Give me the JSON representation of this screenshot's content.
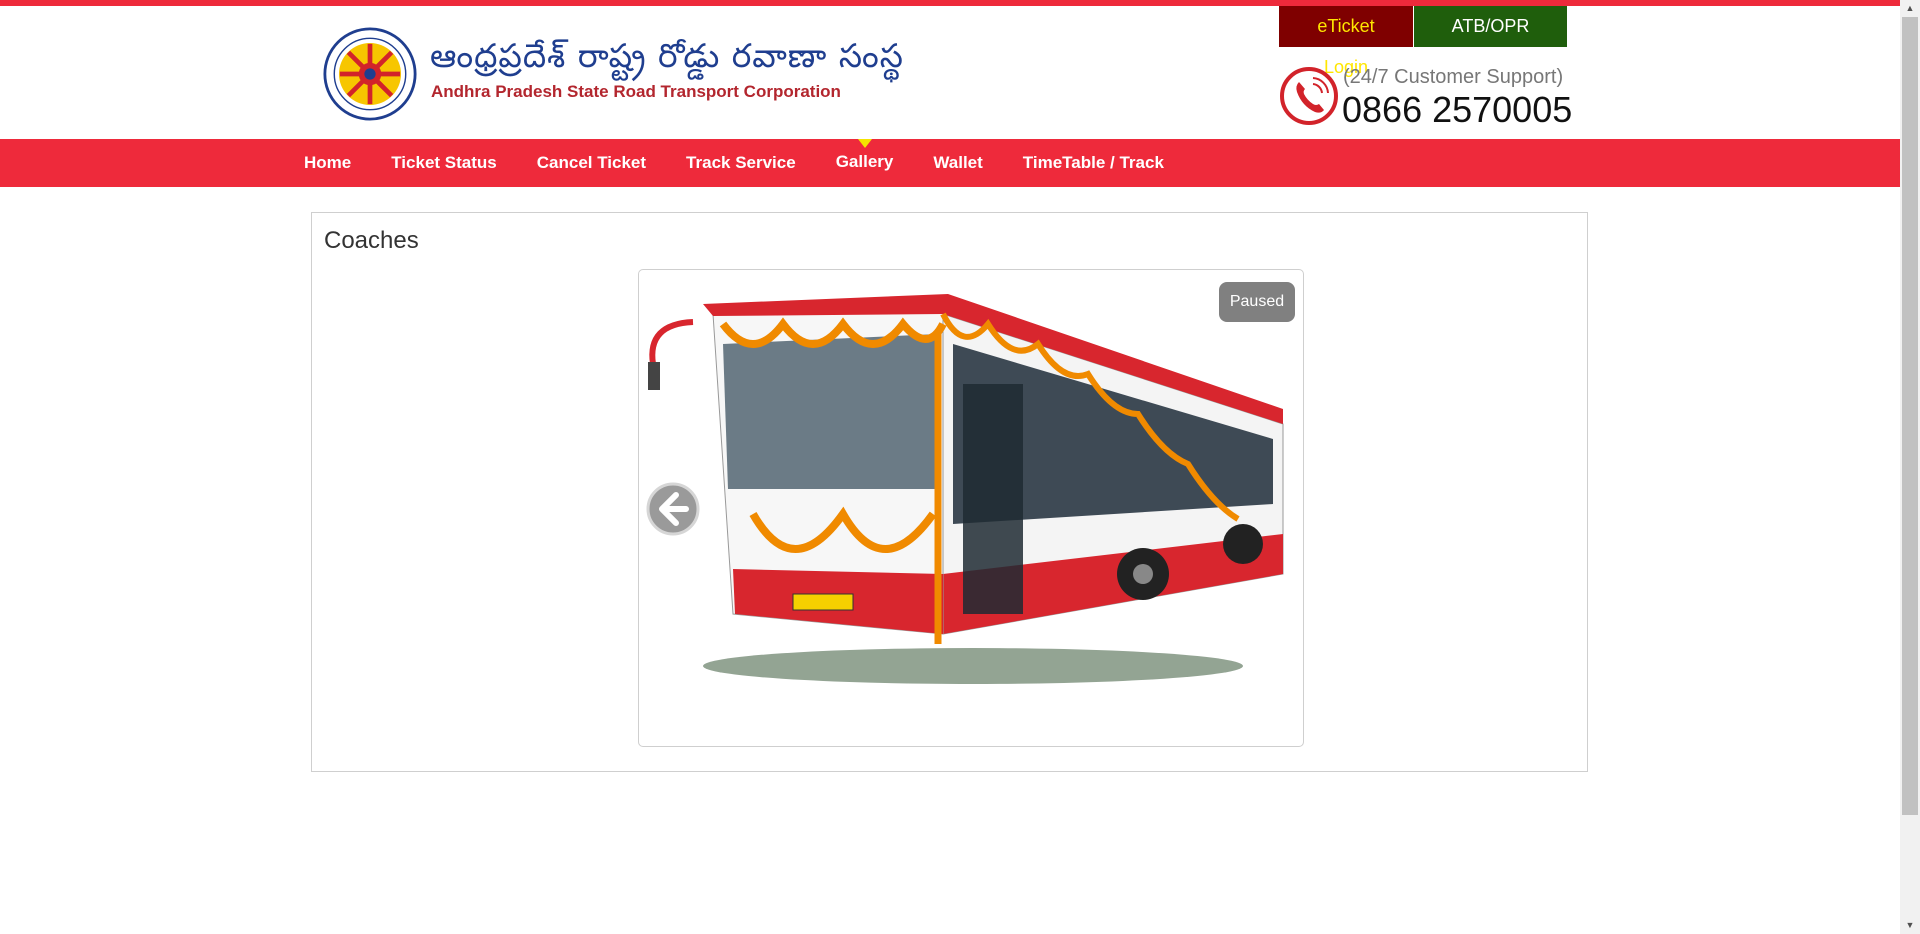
{
  "header": {
    "logo_telugu": "ఆంధ్రప్రదేశ్ రాష్ట్ర రోడ్డు రవాణా సంస్థ",
    "logo_english": "Andhra Pradesh State Road Transport Corporation",
    "eticket_login": "eTicket Login",
    "atb_login": "ATB/OPR Login",
    "support_label": "(24/7 Customer Support)",
    "support_phone": "0866 2570005"
  },
  "nav": {
    "items": [
      {
        "label": "Home"
      },
      {
        "label": "Ticket Status"
      },
      {
        "label": "Cancel Ticket"
      },
      {
        "label": "Track Service"
      },
      {
        "label": "Gallery"
      },
      {
        "label": "Wallet"
      },
      {
        "label": "TimeTable / Track"
      }
    ],
    "active": "Gallery"
  },
  "gallery": {
    "title": "Coaches",
    "status": "Paused"
  },
  "colors": {
    "brand_red": "#ee2a3b",
    "eticket_bg": "#7f0000",
    "eticket_text": "#ffe600",
    "atb_bg": "#1f5e0c",
    "nav_active_marker": "#f5e400"
  },
  "icons": {
    "logo": "apsrtc-emblem-icon",
    "support": "phone-icon",
    "prev": "arrow-left-circle-icon"
  }
}
